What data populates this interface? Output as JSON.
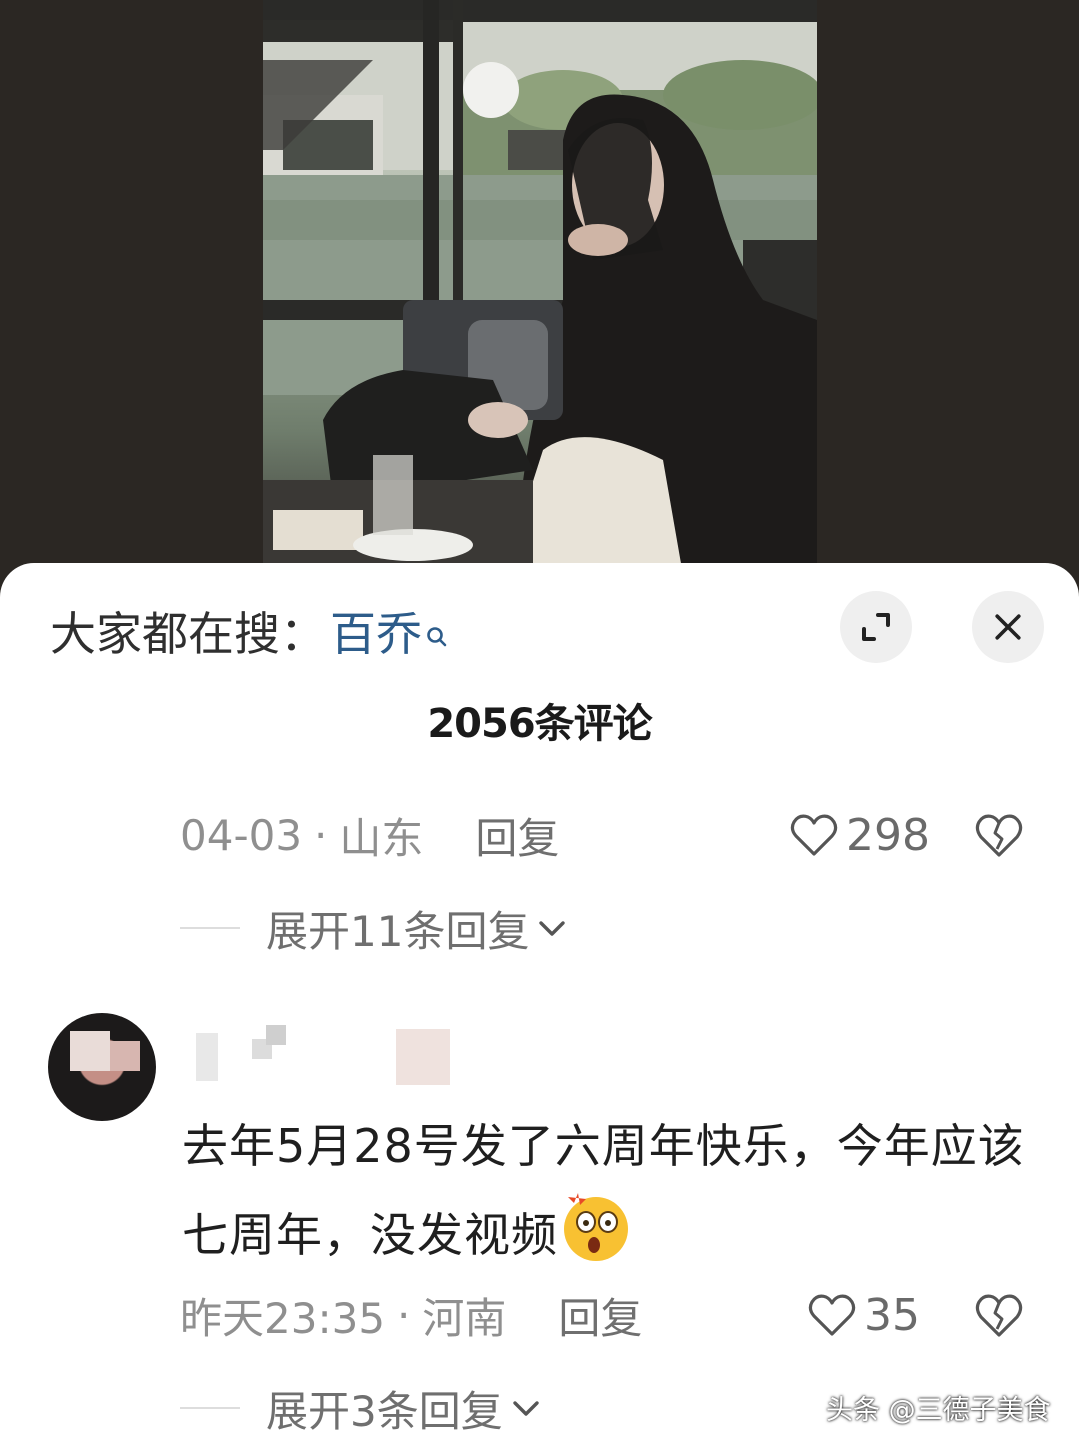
{
  "search": {
    "prefix": "大家都在搜：",
    "term": "百乔"
  },
  "header": {
    "comment_count": "2056条评论"
  },
  "comments": [
    {
      "date": "04-03",
      "location": "山东",
      "reply_label": "回复",
      "likes": "298",
      "expand_label": "展开11条回复"
    },
    {
      "text": "去年5月28号发了六周年快乐，今年应该七周年，没发视频",
      "date": "昨天23:35",
      "location": "河南",
      "reply_label": "回复",
      "likes": "35",
      "expand_label": "展开3条回复"
    }
  ],
  "watermark": "头条 @三德子美食",
  "icons": [
    "search-icon",
    "expand-icon",
    "close-icon",
    "heart-icon",
    "broken-heart-icon",
    "chevron-down-icon",
    "surprised-emoji-icon"
  ]
}
